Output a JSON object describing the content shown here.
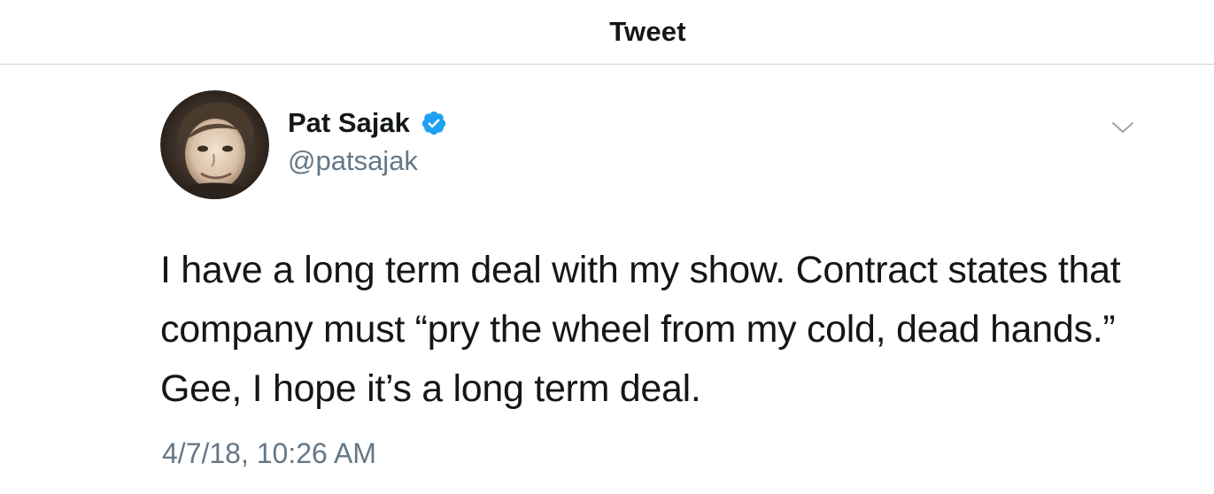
{
  "header": {
    "title": "Tweet"
  },
  "tweet": {
    "author": {
      "display_name": "Pat Sajak",
      "handle": "@patsajak",
      "verified": true
    },
    "text": "I have a long term deal with my show. Contract states that company must “pry the wheel from my cold, dead hands.” Gee, I hope it’s a long term deal.",
    "timestamp": "4/7/18, 10:26 AM"
  },
  "colors": {
    "verified_blue": "#1da1f2",
    "secondary_text": "#657786",
    "primary_text": "#14171a",
    "divider": "#cfd4d8"
  },
  "icons": {
    "verified": "verified-badge-icon",
    "menu": "chevron-down-icon"
  }
}
